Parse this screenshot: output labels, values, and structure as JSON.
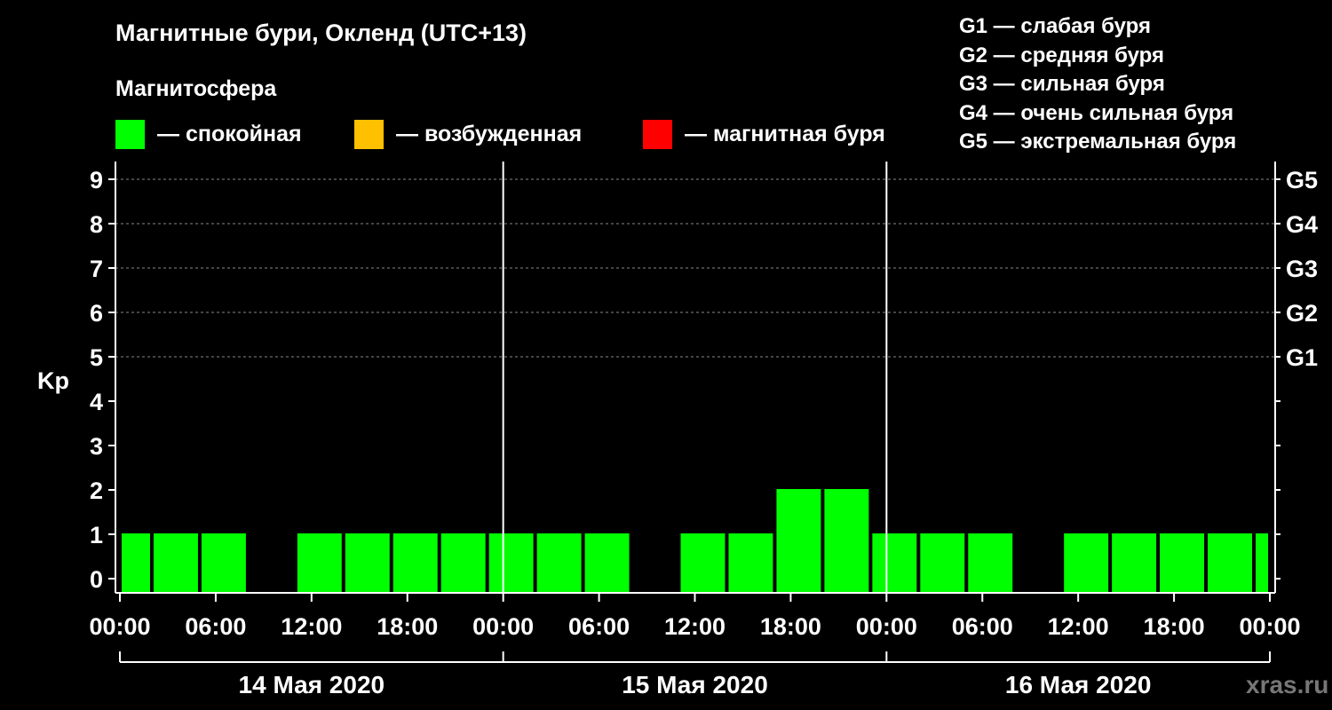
{
  "title": "Магнитные бури, Окленд (UTC+13)",
  "subtitle": "Магнитосфера",
  "legend": [
    {
      "label": "— спокойная",
      "color": "#00ff00"
    },
    {
      "label": "— возбужденная",
      "color": "#ffc000"
    },
    {
      "label": "— магнитная буря",
      "color": "#ff0000"
    }
  ],
  "g_scale": [
    "G1 — слабая буря",
    "G2 — средняя буря",
    "G3 — сильная буря",
    "G4 — очень сильная буря",
    "G5 — экстремальная буря"
  ],
  "watermark": "xras.ru",
  "colors": {
    "background": "#000000",
    "axis": "#ffffff",
    "grid": "#888888",
    "quiet": "#00ff00"
  },
  "chart_data": {
    "type": "bar",
    "ylabel": "Kp",
    "ylim": [
      0,
      9
    ],
    "yticks": [
      "0",
      "1",
      "2",
      "3",
      "4",
      "5",
      "6",
      "7",
      "8",
      "9"
    ],
    "right_labels": [
      {
        "value": 5,
        "label": "G1"
      },
      {
        "value": 6,
        "label": "G2"
      },
      {
        "value": 7,
        "label": "G3"
      },
      {
        "value": 8,
        "label": "G4"
      },
      {
        "value": 9,
        "label": "G5"
      }
    ],
    "x_tick_labels": [
      "00:00",
      "06:00",
      "12:00",
      "18:00",
      "00:00",
      "06:00",
      "12:00",
      "18:00",
      "00:00",
      "06:00",
      "12:00",
      "18:00",
      "00:00"
    ],
    "dates": [
      "14 Мая 2020",
      "15 Мая 2020",
      "16 Мая 2020"
    ],
    "grid": true,
    "bars": [
      {
        "start_hour": 0,
        "end_hour": 2,
        "value": 1
      },
      {
        "start_hour": 2,
        "end_hour": 5,
        "value": 1
      },
      {
        "start_hour": 5,
        "end_hour": 8,
        "value": 1
      },
      {
        "start_hour": 8,
        "end_hour": 11,
        "value": 0
      },
      {
        "start_hour": 11,
        "end_hour": 14,
        "value": 1
      },
      {
        "start_hour": 14,
        "end_hour": 17,
        "value": 1
      },
      {
        "start_hour": 17,
        "end_hour": 20,
        "value": 1
      },
      {
        "start_hour": 20,
        "end_hour": 23,
        "value": 1
      },
      {
        "start_hour": 23,
        "end_hour": 26,
        "value": 1
      },
      {
        "start_hour": 26,
        "end_hour": 29,
        "value": 1
      },
      {
        "start_hour": 29,
        "end_hour": 32,
        "value": 1
      },
      {
        "start_hour": 32,
        "end_hour": 35,
        "value": 0
      },
      {
        "start_hour": 35,
        "end_hour": 38,
        "value": 1
      },
      {
        "start_hour": 38,
        "end_hour": 41,
        "value": 1
      },
      {
        "start_hour": 41,
        "end_hour": 44,
        "value": 2
      },
      {
        "start_hour": 44,
        "end_hour": 47,
        "value": 2
      },
      {
        "start_hour": 47,
        "end_hour": 50,
        "value": 1
      },
      {
        "start_hour": 50,
        "end_hour": 53,
        "value": 1
      },
      {
        "start_hour": 53,
        "end_hour": 56,
        "value": 1
      },
      {
        "start_hour": 56,
        "end_hour": 59,
        "value": 0
      },
      {
        "start_hour": 59,
        "end_hour": 62,
        "value": 1
      },
      {
        "start_hour": 62,
        "end_hour": 65,
        "value": 1
      },
      {
        "start_hour": 65,
        "end_hour": 68,
        "value": 1
      },
      {
        "start_hour": 68,
        "end_hour": 71,
        "value": 1
      },
      {
        "start_hour": 71,
        "end_hour": 72,
        "value": 1
      }
    ]
  }
}
